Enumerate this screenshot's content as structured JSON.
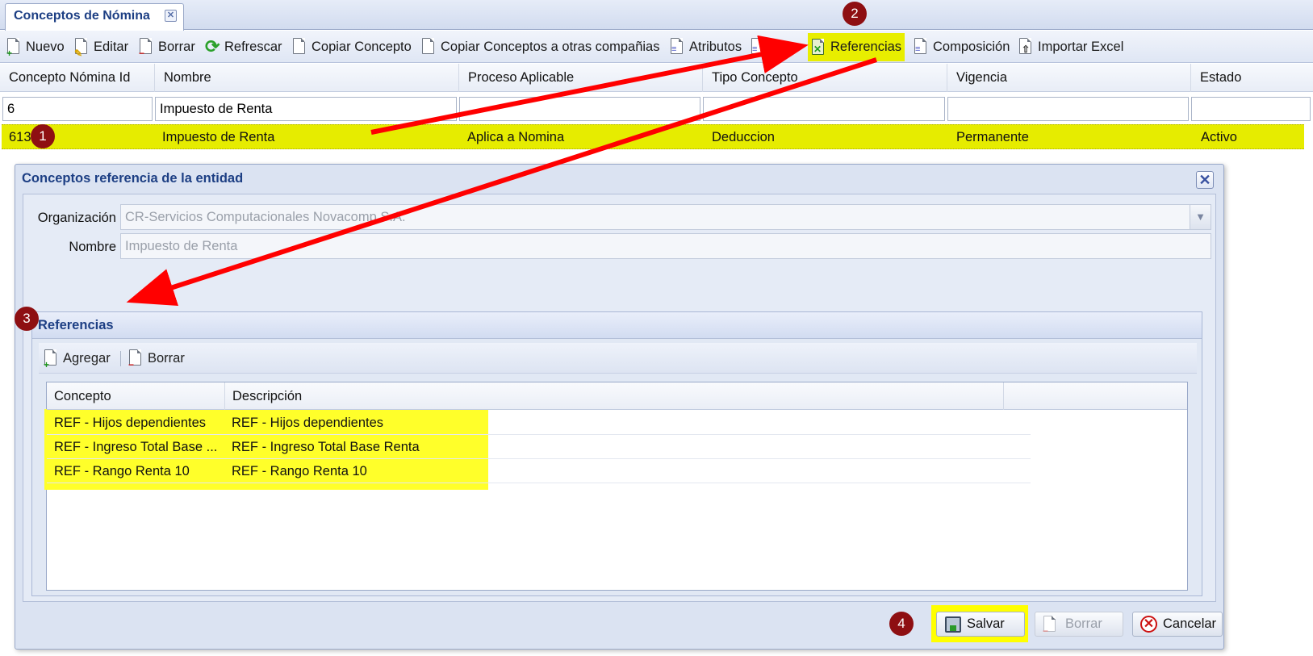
{
  "tab": {
    "title": "Conceptos de Nómina",
    "close_glyph": "✕"
  },
  "toolbar": {
    "nuevo": "Nuevo",
    "editar": "Editar",
    "borrar": "Borrar",
    "refrescar": "Refrescar",
    "copiar_concepto": "Copiar Concepto",
    "copiar_conceptos_otras": "Copiar Conceptos a otras compañias",
    "atributos": "Atributos",
    "filtrar_partial": "rfer",
    "referencias": "Referencias",
    "composicion": "Composición",
    "importar_excel": "Importar Excel"
  },
  "grid": {
    "columns": [
      "Concepto Nómina Id",
      "Nombre",
      "Proceso Aplicable",
      "Tipo Concepto",
      "Vigencia",
      "Estado"
    ],
    "filters": {
      "id": "6",
      "nombre": "Impuesto de Renta"
    },
    "row": {
      "id": "613",
      "nombre": "Impuesto de Renta",
      "proceso": "Aplica a Nomina",
      "tipo": "Deduccion",
      "vigencia": "Permanente",
      "estado": "Activo"
    }
  },
  "modal": {
    "title": "Conceptos referencia de la entidad",
    "close_glyph": "✕",
    "org_label": "Organización",
    "org_value": "CR-Servicios Computacionales Novacomp S.A.",
    "nombre_label": "Nombre",
    "nombre_value": "Impuesto de Renta",
    "referencias": {
      "title": "Referencias",
      "agregar": "Agregar",
      "borrar": "Borrar",
      "columns": [
        "Concepto",
        "Descripción"
      ],
      "rows": [
        {
          "concepto": "REF - Hijos dependientes",
          "descripcion": "REF - Hijos dependientes"
        },
        {
          "concepto": "REF - Ingreso Total Base ...",
          "descripcion": "REF - Ingreso Total Base Renta"
        },
        {
          "concepto": "REF - Rango Renta 10",
          "descripcion": "REF - Rango Renta 10"
        }
      ]
    },
    "footer": {
      "salvar": "Salvar",
      "borrar": "Borrar",
      "cancelar": "Cancelar"
    }
  },
  "annotations": {
    "m1": "1",
    "m2": "2",
    "m3": "3",
    "m4": "4",
    "color": "#8e0f12",
    "arrow_color": "#ff0000",
    "highlight_color": "#e6ec00"
  }
}
